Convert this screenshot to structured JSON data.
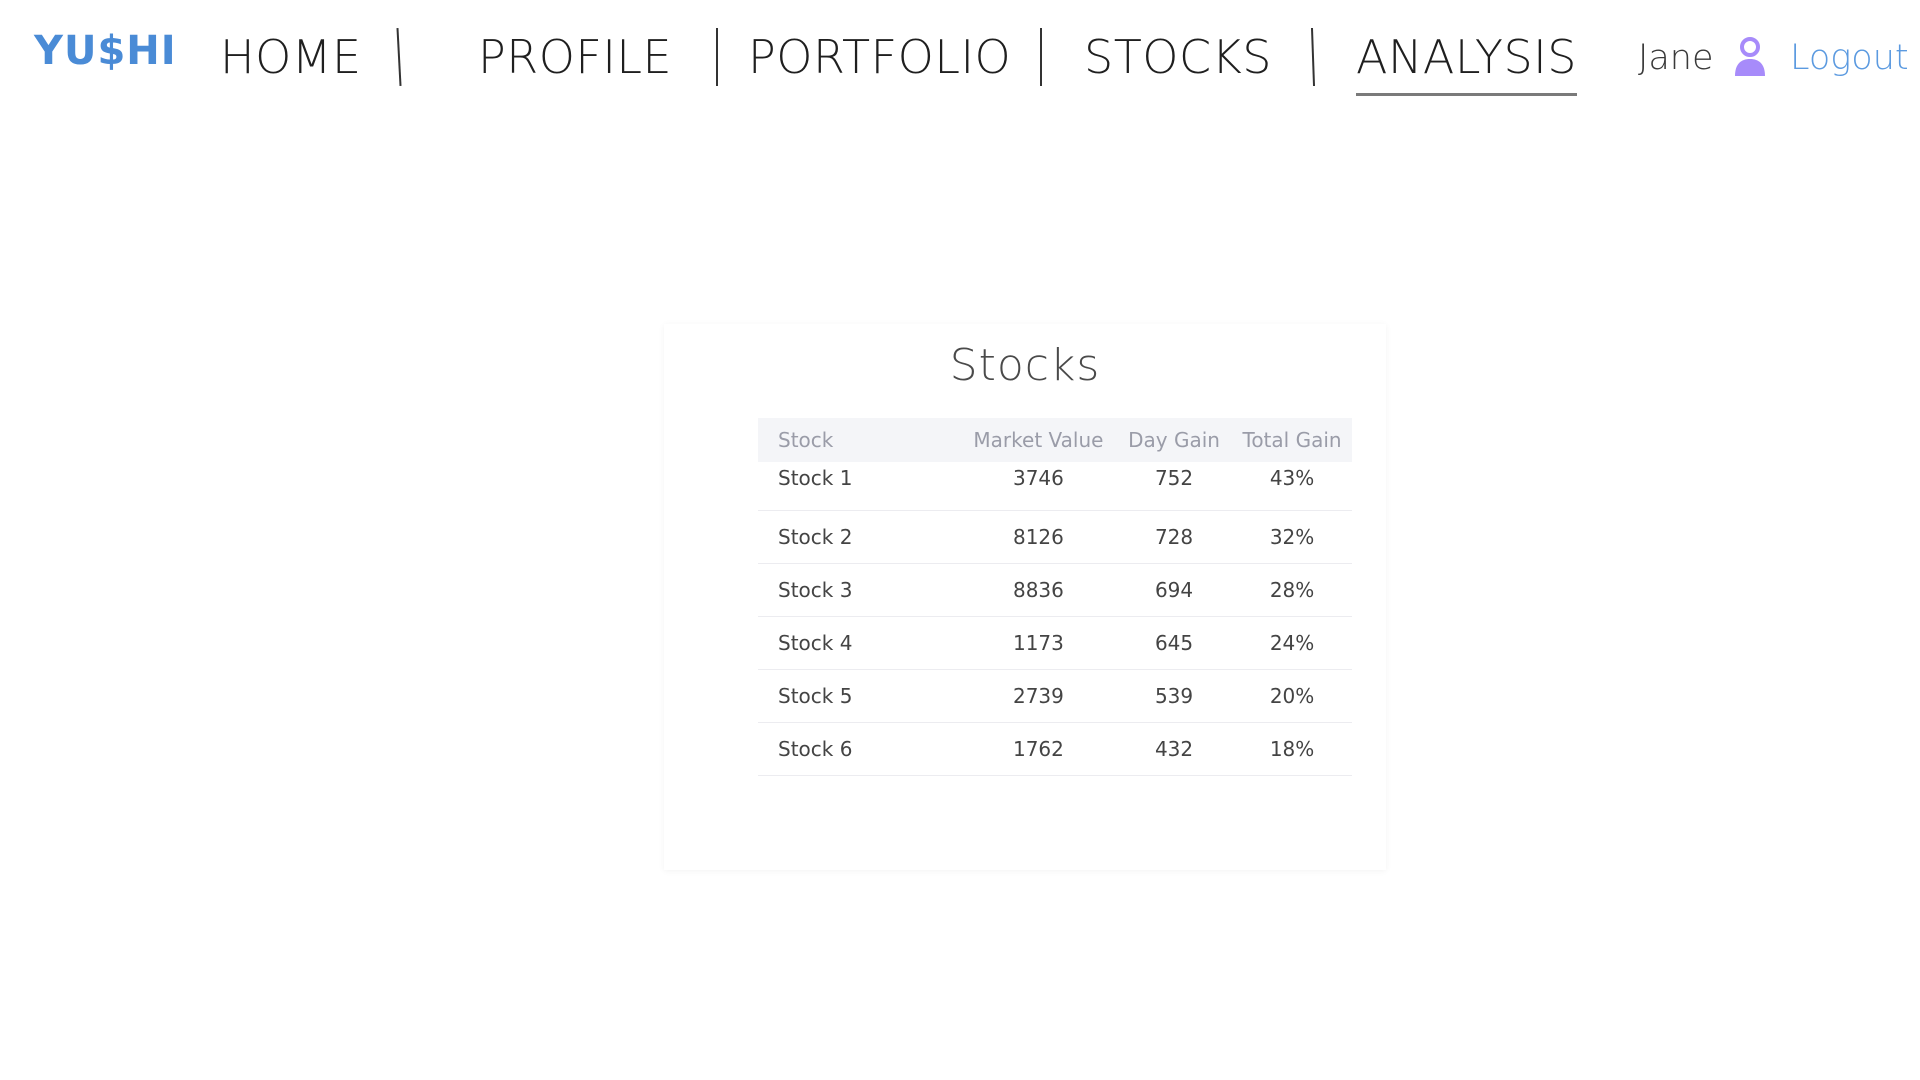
{
  "header": {
    "logo": "YU$HI",
    "nav": [
      {
        "label": "HOME"
      },
      {
        "label": "PROFILE"
      },
      {
        "label": "PORTFOLIO"
      },
      {
        "label": "STOCKS"
      },
      {
        "label": "ANALYSIS",
        "active": true
      }
    ],
    "user_name": "Jane",
    "user_icon": "user-icon",
    "logout_label": "Logout",
    "colors": {
      "brand": "#4a8bd6",
      "logout": "#5b9ae0",
      "user_icon": "#a78bfa"
    }
  },
  "card": {
    "title": "Stocks",
    "table": {
      "headers": [
        "Stock",
        "Market Value",
        "Day Gain",
        "Total Gain"
      ],
      "rows": [
        [
          "Stock 1",
          "3746",
          "752",
          "43%"
        ],
        [
          "Stock 2",
          "8126",
          "728",
          "32%"
        ],
        [
          "Stock 3",
          "8836",
          "694",
          "28%"
        ],
        [
          "Stock 4",
          "1173",
          "645",
          "24%"
        ],
        [
          "Stock 5",
          "2739",
          "539",
          "20%"
        ],
        [
          "Stock 6",
          "1762",
          "432",
          "18%"
        ]
      ]
    }
  }
}
